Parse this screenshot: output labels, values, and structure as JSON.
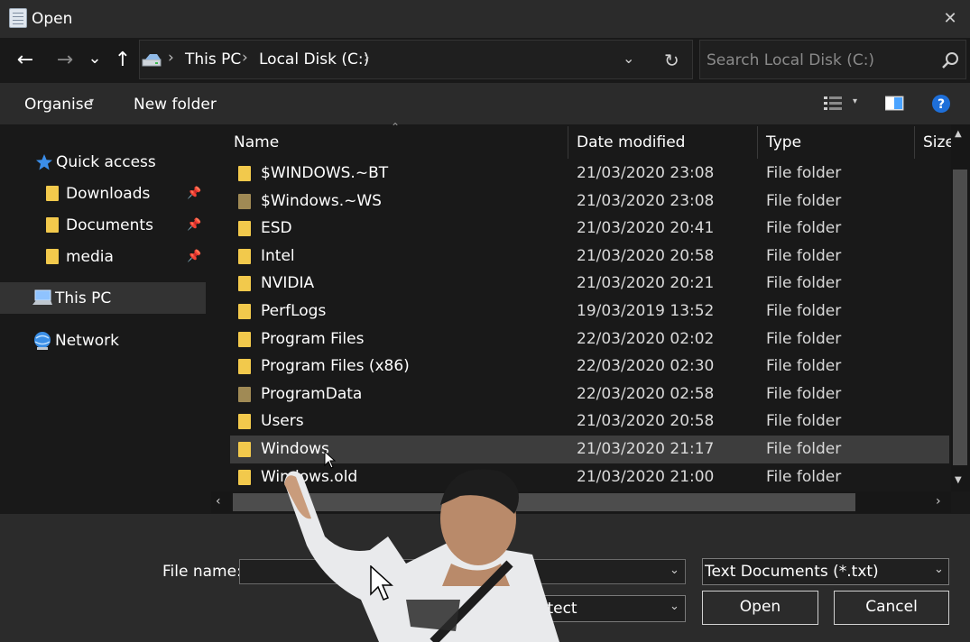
{
  "window": {
    "title": "Open",
    "close_glyph": "✕"
  },
  "nav": {
    "back_glyph": "←",
    "forward_glyph": "→",
    "recent_glyph": "⌄",
    "up_glyph": "↑",
    "breadcrumbs": [
      "This PC",
      "Local Disk (C:)"
    ],
    "refresh_glyph": "↻",
    "search_placeholder": "Search Local Disk (C:)"
  },
  "toolbar": {
    "organise_label": "Organise",
    "new_folder_label": "New folder"
  },
  "sidebar": {
    "quick_access": "Quick access",
    "pinned": [
      {
        "label": "Downloads"
      },
      {
        "label": "Documents"
      },
      {
        "label": "media"
      }
    ],
    "this_pc": "This PC",
    "network": "Network"
  },
  "columns": {
    "name": "Name",
    "date": "Date modified",
    "type": "Type",
    "size": "Size"
  },
  "files": [
    {
      "name": "$WINDOWS.~BT",
      "date": "21/03/2020 23:08",
      "type": "File folder",
      "hidden": false
    },
    {
      "name": "$Windows.~WS",
      "date": "21/03/2020 23:08",
      "type": "File folder",
      "hidden": true
    },
    {
      "name": "ESD",
      "date": "21/03/2020 20:41",
      "type": "File folder",
      "hidden": false
    },
    {
      "name": "Intel",
      "date": "21/03/2020 20:58",
      "type": "File folder",
      "hidden": false
    },
    {
      "name": "NVIDIA",
      "date": "21/03/2020 20:21",
      "type": "File folder",
      "hidden": false
    },
    {
      "name": "PerfLogs",
      "date": "19/03/2019 13:52",
      "type": "File folder",
      "hidden": false
    },
    {
      "name": "Program Files",
      "date": "22/03/2020 02:02",
      "type": "File folder",
      "hidden": false
    },
    {
      "name": "Program Files (x86)",
      "date": "22/03/2020 02:30",
      "type": "File folder",
      "hidden": false
    },
    {
      "name": "ProgramData",
      "date": "22/03/2020 02:58",
      "type": "File folder",
      "hidden": true
    },
    {
      "name": "Users",
      "date": "21/03/2020 20:58",
      "type": "File folder",
      "hidden": false
    },
    {
      "name": "Windows",
      "date": "21/03/2020 21:17",
      "type": "File folder",
      "hidden": false
    },
    {
      "name": "Windows.old",
      "date": "21/03/2020 21:00",
      "type": "File folder",
      "hidden": false
    }
  ],
  "bottom": {
    "file_name_label": "File name:",
    "file_name_value": "",
    "filter_value": "Text Documents (*.txt)",
    "encoding_partial": "etect",
    "open_label": "Open",
    "cancel_label": "Cancel"
  },
  "colors": {
    "accent": "#1e6fd9",
    "folder": "#f2c94c",
    "hover_row": "#3d3d3d"
  },
  "icons": [
    "notepad-icon",
    "drive-icon",
    "search-icon",
    "view-list-icon",
    "preview-pane-icon",
    "help-icon",
    "star-icon",
    "folder-icon",
    "pin-icon",
    "computer-icon",
    "network-icon",
    "mouse-cursor-icon"
  ]
}
